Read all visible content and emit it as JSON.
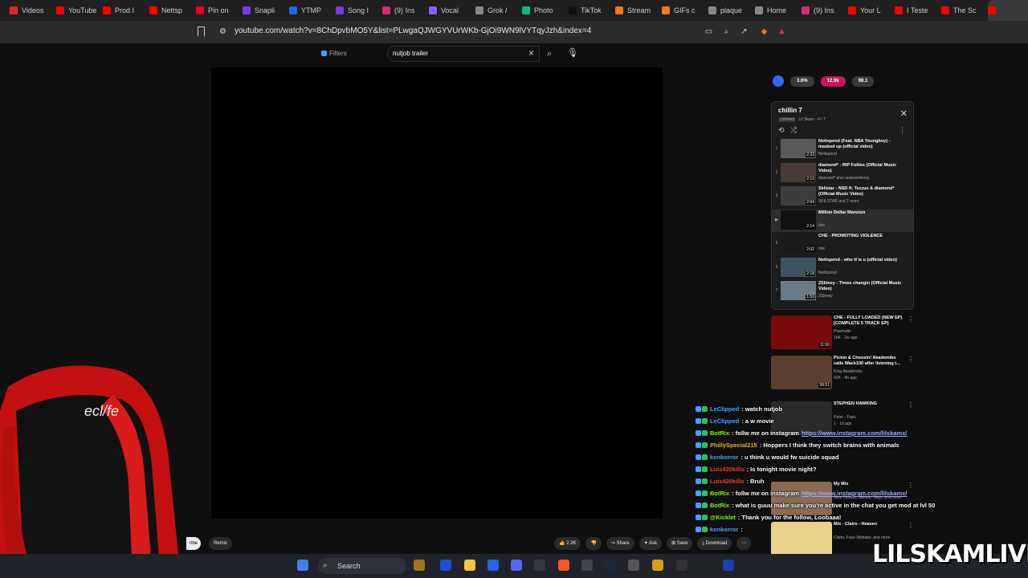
{
  "browser": {
    "tabs": [
      {
        "label": "Videos",
        "color": "#e02424"
      },
      {
        "label": "YouTube",
        "color": "#ff0000"
      },
      {
        "label": "Prod I",
        "color": "#ff0000"
      },
      {
        "label": "Nettsp",
        "color": "#ff0000"
      },
      {
        "label": "Pin on",
        "color": "#e60023"
      },
      {
        "label": "Snapli",
        "color": "#7c3aed"
      },
      {
        "label": "YTMP",
        "color": "#2563eb"
      },
      {
        "label": "Song I",
        "color": "#7c3aed"
      },
      {
        "label": "(9) Ins",
        "color": "#d62976"
      },
      {
        "label": "Vocal",
        "color": "#8b5cf6"
      },
      {
        "label": "Grok /",
        "color": "#888888"
      },
      {
        "label": "Photo",
        "color": "#10b981"
      },
      {
        "label": "TikTok",
        "color": "#111111"
      },
      {
        "label": "Stream",
        "color": "#f97316"
      },
      {
        "label": "GIFs c",
        "color": "#f97316"
      },
      {
        "label": "plaque",
        "color": "#888888"
      },
      {
        "label": "Home",
        "color": "#888888"
      },
      {
        "label": "(9) Ins",
        "color": "#d62976"
      },
      {
        "label": "Your L",
        "color": "#ff0000"
      },
      {
        "label": "I Teste",
        "color": "#ff0000"
      },
      {
        "label": "The Sc",
        "color": "#ff0000"
      },
      {
        "label": "",
        "color": "#ff0000"
      },
      {
        "label": "Ho",
        "color": "#888888"
      }
    ],
    "url": "youtube.com/watch?v=8ChDpvbMO5Y&list=PLwgaQJWGYVUrWKb-GjOi9WN9lVYTqyJzh&index=4"
  },
  "header": {
    "filters_label": "Filters",
    "search_query": "nutjob trailer"
  },
  "stats": [
    "3.6%",
    "12.9k",
    "98.1"
  ],
  "playlist": {
    "title": "chillin 7",
    "badge": "Unlisted",
    "subtitle": "Lil Skam - 4 / 7",
    "items": [
      {
        "num": "1",
        "title": "Nettspend (Feat. NBA Youngboy) - masked up (official video)",
        "channel": "Nettspend",
        "duration": "2:23"
      },
      {
        "num": "2",
        "title": "diamond* - RIP Follies (Official Music Video)",
        "channel": "diamond* and xavierenthony",
        "duration": "2:13"
      },
      {
        "num": "3",
        "title": "Skilstar - NSD ft. Tezzus & diamond* (Official Music Video)",
        "channel": "SKILSTAR and 2 more",
        "duration": "2:04"
      },
      {
        "num": "▶",
        "title": "Million Dollar Mansion",
        "channel": "che",
        "duration": "2:14"
      },
      {
        "num": "5",
        "title": "CHE - PROMOTING VIOLENCE",
        "channel": "che",
        "duration": "2:02"
      },
      {
        "num": "6",
        "title": "Nettspend - who tf is u (official video)",
        "channel": "Nettspend",
        "duration": "2:18"
      },
      {
        "num": "7",
        "title": "2Slimey - Times changin (Official Music Video)",
        "channel": "2Slimey",
        "duration": "1:53"
      }
    ]
  },
  "recommendations": [
    {
      "title": "CHE - FULLY LOADED (NEW EP) [COMPLETE 5 TRACK EP]",
      "channel": "Plasmatic",
      "meta": "16K · 2w ago",
      "duration": "11:50"
    },
    {
      "title": "Pickin & Choosin! Akademiks calls Wack100 after listening t...",
      "channel": "King Akademiks",
      "meta": "42K · 4h ago",
      "duration": "58:51"
    },
    {
      "title": "STEPHEN HAWKING",
      "channel": "Peter - Topic",
      "meta": "1 · 1d ago",
      "duration": ""
    },
    {
      "title": "My Mix",
      "channel": "Nine Vicious, Skilstar, Slayr, and more",
      "meta": "",
      "duration": ""
    },
    {
      "title": "Mix - Clairo - Heaven",
      "channel": "Clairo, Faye Webster, and more",
      "meta": "",
      "duration": ""
    }
  ],
  "chat": [
    {
      "user": "LeClipped",
      "text": ": watch nutjob",
      "link": ""
    },
    {
      "user": "LeClipped",
      "text": ": a w movie",
      "link": ""
    },
    {
      "user": "BotRix",
      "text": ": follw me on instagram",
      "link": "https://www.instagram.com/lilskamx/"
    },
    {
      "user": "PhillySpecial215",
      "text": ": Hoppers I think they switch brains with animals",
      "link": ""
    },
    {
      "user": "konkorror",
      "text": ": u think u would fw suicide squad",
      "link": ""
    },
    {
      "user": "Luis420kills",
      "text": ": Is tonight movie night?",
      "link": ""
    },
    {
      "user": "Luis420kills",
      "text": ": Bruh",
      "link": ""
    },
    {
      "user": "BotRix",
      "text": ": follw me on instagram",
      "link": "https://www.instagram.com/lilskamx/"
    },
    {
      "user": "BotRix",
      "text": ": what is guuu make sure you're active in the chat you get mod at lvl 50",
      "link": ""
    },
    {
      "user": "@Kicklet",
      "text": ": Thank you for the follow, Loobaaa!",
      "link": ""
    },
    {
      "user": "konkorror",
      "text": ":",
      "link": ""
    }
  ],
  "chat_user_colors": [
    "#3ea6ff",
    "#3ea6ff",
    "#7cfc00",
    "#f5a623",
    "#3ea6ff",
    "#e53935",
    "#e53935",
    "#7cfc00",
    "#7cfc00",
    "#7cfc00",
    "#3ea6ff"
  ],
  "actions": {
    "remix": "Remix",
    "subscribe_fragment": "ribe",
    "like_count": "2.3K",
    "share": "Share",
    "ask": "Ask",
    "save": "Save",
    "download": "Download"
  },
  "taskbar": {
    "search_label": "Search"
  },
  "chair_logo_text": "ecl/fe",
  "watermark": "LILSKAMLIVE"
}
